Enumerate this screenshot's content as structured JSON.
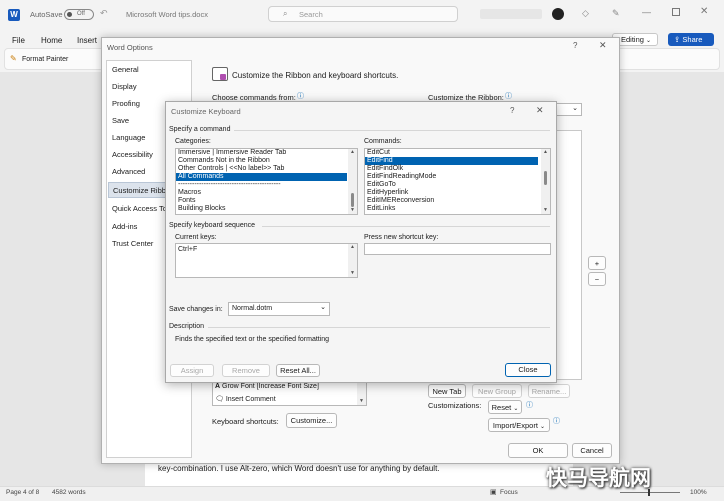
{
  "titlebar": {
    "autosave_label": "AutoSave",
    "autosave_state": "Off",
    "doc_title": "Microsoft Word tips.docx",
    "search_placeholder": "Search"
  },
  "ribbon": {
    "tabs": [
      "File",
      "Home",
      "Insert"
    ],
    "format_painter": "Format Painter",
    "editing_label": "Editing",
    "share_label": "Share"
  },
  "word_options": {
    "title": "Word Options",
    "nav": [
      "General",
      "Display",
      "Proofing",
      "Save",
      "Language",
      "Accessibility",
      "Advanced",
      "Customize Ribbon",
      "Quick Access Toolbar",
      "Add-ins",
      "Trust Center"
    ],
    "selected_nav": 7,
    "heading": "Customize the Ribbon and keyboard shortcuts.",
    "choose_commands_label": "Choose commands from:",
    "customize_ribbon_label": "Customize the Ribbon:",
    "left_list_items": [
      "Grow Font [Increase Font Size]",
      "Insert Comment"
    ],
    "keyboard_shortcuts_label": "Keyboard shortcuts:",
    "customize_button": "Customize...",
    "new_tab": "New Tab",
    "new_group": "New Group",
    "rename": "Rename...",
    "customizations_label": "Customizations:",
    "reset": "Reset",
    "import_export": "Import/Export",
    "ok": "OK",
    "cancel": "Cancel"
  },
  "customize_keyboard": {
    "title": "Customize Keyboard",
    "specify_command": "Specify a command",
    "categories_label": "Categories:",
    "categories": [
      "Immersive | Immersive Reader Tab",
      "Commands Not in the Ribbon",
      "Other Controls | <<No label>> Tab",
      "All Commands",
      "--------------------------------------------",
      "Macros",
      "Fonts",
      "Building Blocks"
    ],
    "selected_category": 3,
    "commands_label": "Commands:",
    "commands": [
      "EditCut",
      "EditFind",
      "EditFindOlk",
      "EditFindReadingMode",
      "EditGoTo",
      "EditHyperlink",
      "EditIMEReconversion",
      "EditLinks"
    ],
    "selected_command": 1,
    "specify_sequence": "Specify keyboard sequence",
    "current_keys_label": "Current keys:",
    "current_keys": [
      "Ctrl+F"
    ],
    "press_new_label": "Press new shortcut key:",
    "press_new_value": "",
    "save_changes_label": "Save changes in:",
    "save_changes_value": "Normal.dotm",
    "description_label": "Description",
    "description_text": "Finds the specified text or the specified formatting",
    "assign": "Assign",
    "remove": "Remove",
    "reset_all": "Reset All...",
    "close": "Close"
  },
  "document": {
    "body_text": "key-combination. I use Alt-zero, which Word doesn't use for anything by default."
  },
  "statusbar": {
    "page": "Page 4 of 8",
    "words": "4582 words",
    "focus": "Focus",
    "zoom": "100%"
  },
  "watermark": "快马导航网",
  "colors": {
    "word_blue": "#185abd",
    "accent": "#0063b1"
  }
}
